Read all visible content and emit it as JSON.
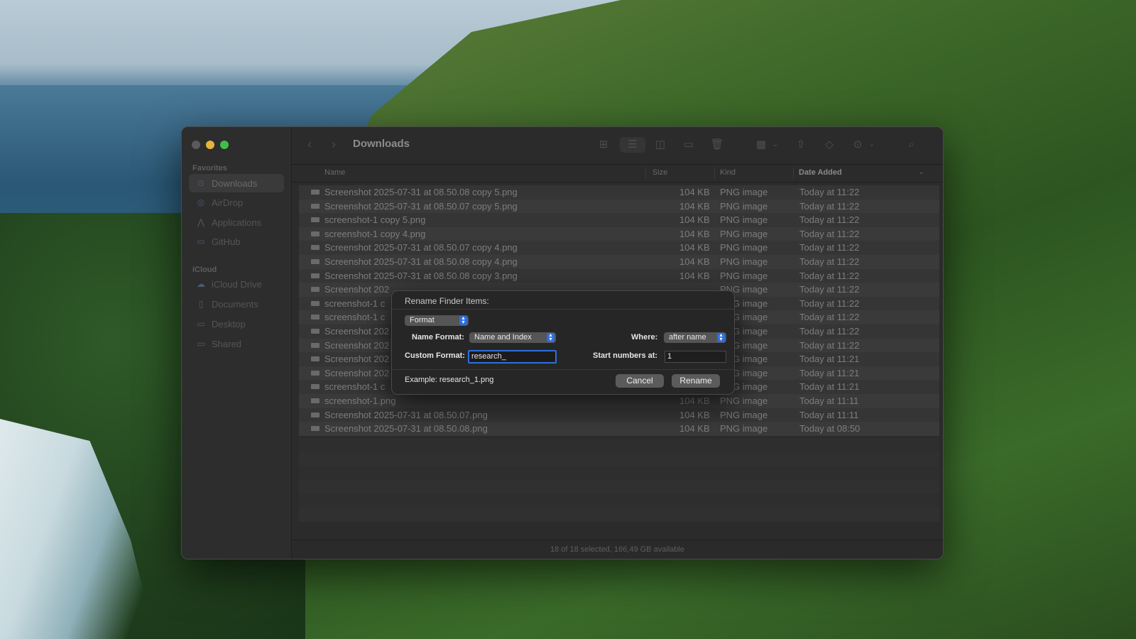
{
  "window": {
    "title": "Downloads",
    "back_icon": "chevron-left-icon",
    "forward_icon": "chevron-right-icon"
  },
  "sidebar": {
    "favorites_label": "Favorites",
    "favorites": [
      {
        "label": "Downloads",
        "icon": "download-icon",
        "selected": true
      },
      {
        "label": "AirDrop",
        "icon": "airdrop-icon"
      },
      {
        "label": "Applications",
        "icon": "applications-icon"
      },
      {
        "label": "GitHub",
        "icon": "folder-icon"
      }
    ],
    "icloud_label": "iCloud",
    "icloud": [
      {
        "label": "iCloud Drive",
        "icon": "cloud-icon"
      },
      {
        "label": "Documents",
        "icon": "document-icon"
      },
      {
        "label": "Desktop",
        "icon": "desktop-icon"
      },
      {
        "label": "Shared",
        "icon": "shared-folder-icon"
      }
    ]
  },
  "columns": {
    "name": "Name",
    "size": "Size",
    "kind": "Kind",
    "date_added": "Date Added"
  },
  "files": [
    {
      "name": "Screenshot 2025-07-31 at 08.50.08 copy 5.png",
      "size": "104 KB",
      "kind": "PNG image",
      "date": "Today at 11:22"
    },
    {
      "name": "Screenshot 2025-07-31 at 08.50.07 copy 5.png",
      "size": "104 KB",
      "kind": "PNG image",
      "date": "Today at 11:22"
    },
    {
      "name": "screenshot-1 copy 5.png",
      "size": "104 KB",
      "kind": "PNG image",
      "date": "Today at 11:22"
    },
    {
      "name": "screenshot-1 copy 4.png",
      "size": "104 KB",
      "kind": "PNG image",
      "date": "Today at 11:22"
    },
    {
      "name": "Screenshot 2025-07-31 at 08.50.07 copy 4.png",
      "size": "104 KB",
      "kind": "PNG image",
      "date": "Today at 11:22"
    },
    {
      "name": "Screenshot 2025-07-31 at 08.50.08 copy 4.png",
      "size": "104 KB",
      "kind": "PNG image",
      "date": "Today at 11:22"
    },
    {
      "name": "Screenshot 2025-07-31 at 08.50.08 copy 3.png",
      "size": "104 KB",
      "kind": "PNG image",
      "date": "Today at 11:22"
    },
    {
      "name": "Screenshot 202",
      "size": "",
      "kind": "PNG image",
      "date": "Today at 11:22"
    },
    {
      "name": "screenshot-1 c",
      "size": "",
      "kind": "PNG image",
      "date": "Today at 11:22"
    },
    {
      "name": "screenshot-1 c",
      "size": "",
      "kind": "PNG image",
      "date": "Today at 11:22"
    },
    {
      "name": "Screenshot 202",
      "size": "",
      "kind": "PNG image",
      "date": "Today at 11:22"
    },
    {
      "name": "Screenshot 202",
      "size": "",
      "kind": "PNG image",
      "date": "Today at 11:22"
    },
    {
      "name": "Screenshot 202",
      "size": "",
      "kind": "PNG image",
      "date": "Today at 11:21"
    },
    {
      "name": "Screenshot 202",
      "size": "",
      "kind": "PNG image",
      "date": "Today at 11:21"
    },
    {
      "name": "screenshot-1 c",
      "size": "",
      "kind": "PNG image",
      "date": "Today at 11:21"
    },
    {
      "name": "screenshot-1.png",
      "size": "104 KB",
      "kind": "PNG image",
      "date": "Today at 11:11"
    },
    {
      "name": "Screenshot 2025-07-31 at 08.50.07.png",
      "size": "104 KB",
      "kind": "PNG image",
      "date": "Today at 11:11"
    },
    {
      "name": "Screenshot 2025-07-31 at 08.50.08.png",
      "size": "104 KB",
      "kind": "PNG image",
      "date": "Today at 08:50"
    }
  ],
  "status": "18 of 18 selected, 166,49 GB available",
  "dialog": {
    "title": "Rename Finder Items:",
    "mode": "Format",
    "name_format_label": "Name Format:",
    "name_format_value": "Name and Index",
    "where_label": "Where:",
    "where_value": "after name",
    "custom_format_label": "Custom Format:",
    "custom_format_value": "research_",
    "start_numbers_label": "Start numbers at:",
    "start_numbers_value": "1",
    "example": "Example: research_1.png",
    "cancel": "Cancel",
    "rename": "Rename"
  }
}
